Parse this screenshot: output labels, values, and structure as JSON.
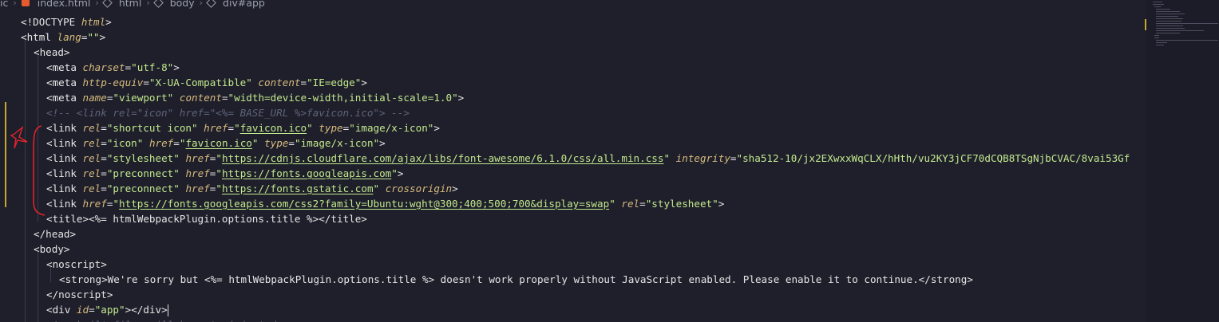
{
  "breadcrumb": [
    "ic",
    "index.html",
    "html",
    "body",
    "div#app"
  ],
  "lines": [
    [
      [
        "tag",
        "<!DOCTYPE "
      ],
      [
        "attr",
        "html"
      ],
      [
        "tag",
        ">"
      ]
    ],
    [
      [
        "tag",
        "<html "
      ],
      [
        "attr",
        "lang"
      ],
      [
        "tag",
        "="
      ],
      [
        "str",
        "\"\""
      ],
      [
        "tag",
        ">"
      ]
    ],
    [
      [
        "tag",
        "<head>"
      ]
    ],
    [
      [
        "tag",
        "<meta "
      ],
      [
        "attr",
        "charset"
      ],
      [
        "tag",
        "="
      ],
      [
        "str",
        "\"utf-8\""
      ],
      [
        "tag",
        ">"
      ]
    ],
    [
      [
        "tag",
        "<meta "
      ],
      [
        "attr",
        "http-equiv"
      ],
      [
        "tag",
        "="
      ],
      [
        "str",
        "\"X-UA-Compatible\""
      ],
      [
        "tag",
        " "
      ],
      [
        "attr",
        "content"
      ],
      [
        "tag",
        "="
      ],
      [
        "str",
        "\"IE=edge\""
      ],
      [
        "tag",
        ">"
      ]
    ],
    [
      [
        "tag",
        "<meta "
      ],
      [
        "attr",
        "name"
      ],
      [
        "tag",
        "="
      ],
      [
        "str",
        "\"viewport\""
      ],
      [
        "tag",
        " "
      ],
      [
        "attr",
        "content"
      ],
      [
        "tag",
        "="
      ],
      [
        "str",
        "\"width=device-width,initial-scale=1.0\""
      ],
      [
        "tag",
        ">"
      ]
    ],
    [
      [
        "comment",
        "<!-- <link rel=\"icon\" href=\"<%= BASE_URL %>favicon.ico\"> -->"
      ]
    ],
    [
      [
        "tag",
        "<link "
      ],
      [
        "attr",
        "rel"
      ],
      [
        "tag",
        "="
      ],
      [
        "str",
        "\"shortcut icon\""
      ],
      [
        "tag",
        " "
      ],
      [
        "attr",
        "href"
      ],
      [
        "tag",
        "="
      ],
      [
        "str",
        "\""
      ],
      [
        "link",
        "favicon.ico"
      ],
      [
        "str",
        "\""
      ],
      [
        "tag",
        " "
      ],
      [
        "attr",
        "type"
      ],
      [
        "tag",
        "="
      ],
      [
        "str",
        "\"image/x-icon\""
      ],
      [
        "tag",
        ">"
      ]
    ],
    [
      [
        "tag",
        "<link "
      ],
      [
        "attr",
        "rel"
      ],
      [
        "tag",
        "="
      ],
      [
        "str",
        "\"icon\""
      ],
      [
        "tag",
        " "
      ],
      [
        "attr",
        "href"
      ],
      [
        "tag",
        "="
      ],
      [
        "str",
        "\""
      ],
      [
        "link",
        "favicon.ico"
      ],
      [
        "str",
        "\""
      ],
      [
        "tag",
        " "
      ],
      [
        "attr",
        "type"
      ],
      [
        "tag",
        "="
      ],
      [
        "str",
        "\"image/x-icon\""
      ],
      [
        "tag",
        ">"
      ]
    ],
    [
      [
        "tag",
        "<link "
      ],
      [
        "attr",
        "rel"
      ],
      [
        "tag",
        "="
      ],
      [
        "str",
        "\"stylesheet\""
      ],
      [
        "tag",
        " "
      ],
      [
        "attr",
        "href"
      ],
      [
        "tag",
        "="
      ],
      [
        "str",
        "\""
      ],
      [
        "link",
        "https://cdnjs.cloudflare.com/ajax/libs/font-awesome/6.1.0/css/all.min.css"
      ],
      [
        "str",
        "\""
      ],
      [
        "tag",
        " "
      ],
      [
        "attr",
        "integrity"
      ],
      [
        "tag",
        "="
      ],
      [
        "str",
        "\"sha512-10/jx2EXwxxWqCLX/hHth/vu2KY3jCF70dCQB8TSgNjbCVAC/8vai53Gf"
      ]
    ],
    [
      [
        "tag",
        "<link "
      ],
      [
        "attr",
        "rel"
      ],
      [
        "tag",
        "="
      ],
      [
        "str",
        "\"preconnect\""
      ],
      [
        "tag",
        " "
      ],
      [
        "attr",
        "href"
      ],
      [
        "tag",
        "="
      ],
      [
        "str",
        "\""
      ],
      [
        "link",
        "https://fonts.googleapis.com"
      ],
      [
        "str",
        "\""
      ],
      [
        "tag",
        ">"
      ]
    ],
    [
      [
        "tag",
        "<link "
      ],
      [
        "attr",
        "rel"
      ],
      [
        "tag",
        "="
      ],
      [
        "str",
        "\"preconnect\""
      ],
      [
        "tag",
        " "
      ],
      [
        "attr",
        "href"
      ],
      [
        "tag",
        "="
      ],
      [
        "str",
        "\""
      ],
      [
        "link",
        "https://fonts.gstatic.com"
      ],
      [
        "str",
        "\""
      ],
      [
        "tag",
        " "
      ],
      [
        "attr",
        "crossorigin"
      ],
      [
        "tag",
        ">"
      ]
    ],
    [
      [
        "tag",
        "<link "
      ],
      [
        "attr",
        "href"
      ],
      [
        "tag",
        "="
      ],
      [
        "str",
        "\""
      ],
      [
        "link",
        "https://fonts.googleapis.com/css2?family=Ubuntu:wght@300;400;500;700&display=swap"
      ],
      [
        "str",
        "\""
      ],
      [
        "tag",
        " "
      ],
      [
        "attr",
        "rel"
      ],
      [
        "tag",
        "="
      ],
      [
        "str",
        "\"stylesheet\""
      ],
      [
        "tag",
        ">"
      ]
    ],
    [
      [
        "tag",
        "<title>"
      ],
      [
        "plain",
        "<%= htmlWebpackPlugin.options.title %>"
      ],
      [
        "tag",
        "</title>"
      ]
    ],
    [
      [
        "tag",
        "</head>"
      ]
    ],
    [
      [
        "tag",
        "<body>"
      ]
    ],
    [
      [
        "tag",
        "<noscript>"
      ]
    ],
    [
      [
        "tag",
        "<strong>"
      ],
      [
        "plain",
        "We're sorry but <%= htmlWebpackPlugin.options.title %> doesn't work properly without JavaScript enabled. Please enable it to continue."
      ],
      [
        "tag",
        "</strong>"
      ]
    ],
    [
      [
        "tag",
        "</noscript>"
      ]
    ],
    [
      [
        "tag",
        "<div "
      ],
      [
        "attr",
        "id"
      ],
      [
        "tag",
        "="
      ],
      [
        "str",
        "\"app\""
      ],
      [
        "tag",
        "></div>"
      ]
    ],
    [
      [
        "comment",
        "<!-- built files will be auto injected -->"
      ]
    ]
  ],
  "colors": {
    "background": "#1e1f2b",
    "tag": "#e6e6e6",
    "attr": "#d7ba7d",
    "string": "#c3e88d",
    "comment": "#5f6478",
    "annotation": "#e0242b",
    "modified": "#c8a52e"
  }
}
